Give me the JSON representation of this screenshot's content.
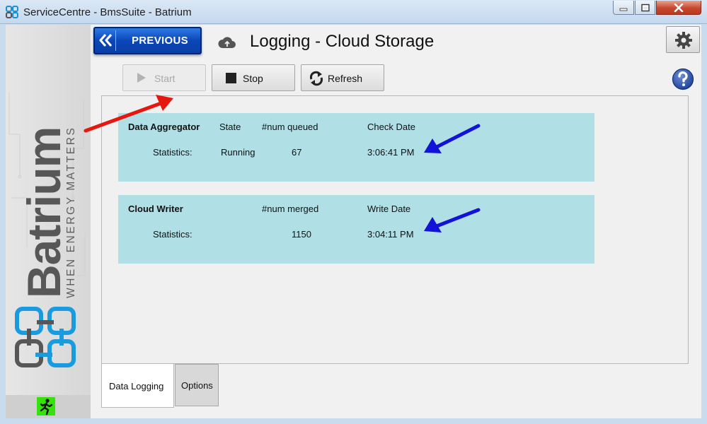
{
  "window": {
    "title": "ServiceCentre - BmsSuite - Batrium"
  },
  "sidebar": {
    "brand": "Batrium",
    "tagline": "WHEN ENERGY MATTERS"
  },
  "header": {
    "previous_label": "PREVIOUS",
    "page_title": "Logging - Cloud Storage"
  },
  "toolbar": {
    "start_label": "Start",
    "stop_label": "Stop",
    "refresh_label": "Refresh"
  },
  "aggregator": {
    "name": "Data Aggregator",
    "state_header": "State",
    "queued_header": "#num queued",
    "date_header": "Check Date",
    "row_label": "Statistics:",
    "state": "Running",
    "queued": "67",
    "date": "3:06:41 PM"
  },
  "writer": {
    "name": "Cloud Writer",
    "merged_header": "#num merged",
    "date_header": "Write Date",
    "row_label": "Statistics:",
    "merged": "1150",
    "date": "3:04:11 PM"
  },
  "tabs": [
    {
      "label": "Data Logging",
      "active": true
    },
    {
      "label": "Options",
      "active": false
    }
  ],
  "colors": {
    "card_bg": "#b0dfe5",
    "previous_btn": "#0b46b8",
    "brand_dark": "#575757",
    "brand_blue": "#199be0",
    "exit_green": "#35e20d",
    "arrow_red": "#e5170f",
    "arrow_blue": "#1212d8"
  }
}
